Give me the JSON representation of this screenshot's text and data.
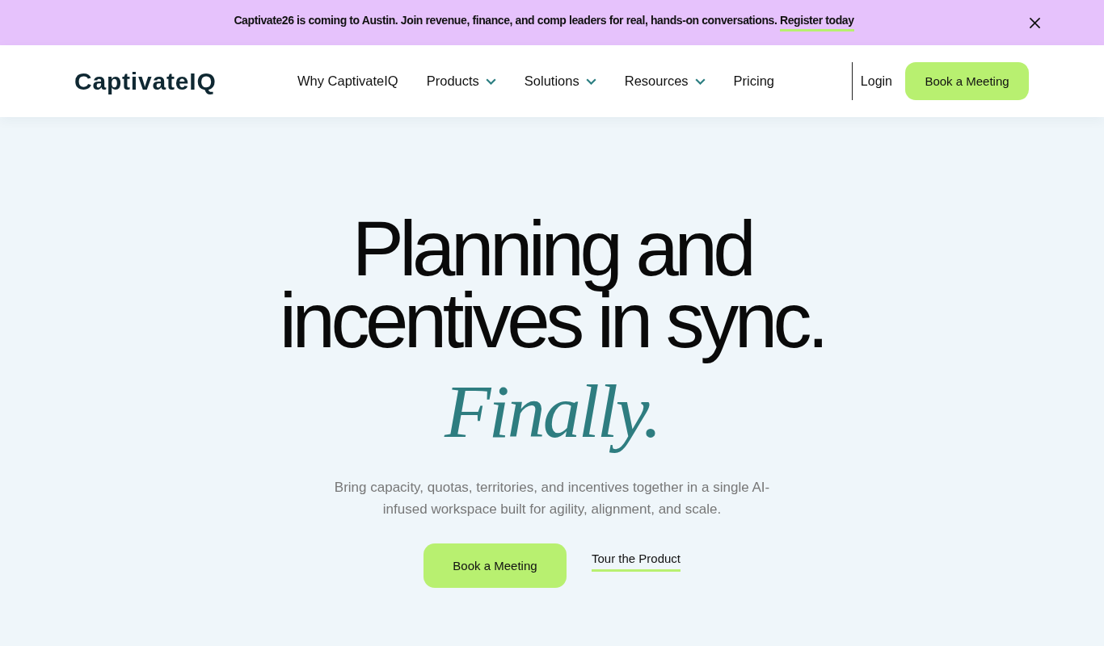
{
  "announcement": {
    "text": "Captivate26 is coming to Austin. Join revenue, finance, and comp leaders for real, hands-on conversations.",
    "link": "Register today"
  },
  "header": {
    "logo": "CaptivateIQ",
    "nav": [
      {
        "label": "Why CaptivateIQ",
        "dropdown": false
      },
      {
        "label": "Products",
        "dropdown": true
      },
      {
        "label": "Solutions",
        "dropdown": true
      },
      {
        "label": "Resources",
        "dropdown": true
      },
      {
        "label": "Pricing",
        "dropdown": false
      }
    ],
    "login": "Login",
    "cta": "Book a Meeting"
  },
  "hero": {
    "heading_lines": [
      "Planning and",
      "incentives in sync."
    ],
    "accent": "Finally.",
    "description": "Bring capacity, quotas, territories, and incentives together in a single AI-infused workspace built for agility, alignment, and scale.",
    "primary_button": "Book a Meeting",
    "secondary_link": "Tour the Product"
  }
}
